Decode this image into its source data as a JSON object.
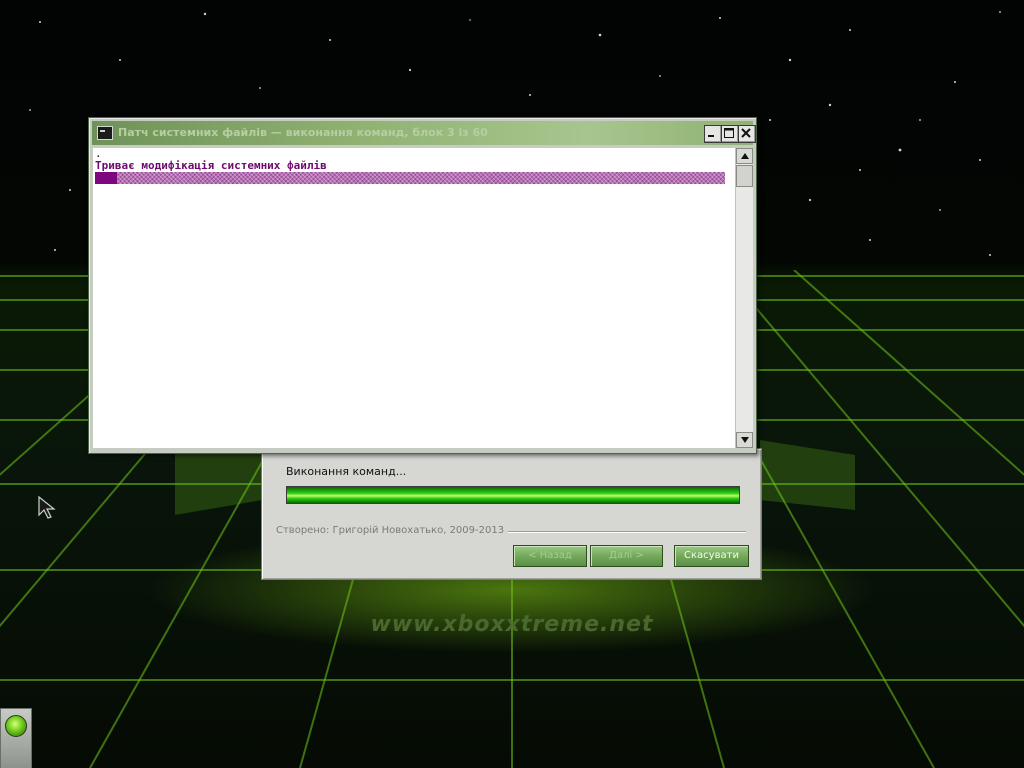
{
  "console": {
    "title": "Патч системних файлів — виконання команд, блок 3 із 60",
    "first_line": ".",
    "status_line": "Триває модифікація системних файлів",
    "progress_fraction": 0.035,
    "icons": {
      "app": "console-icon",
      "minimize": "minimize-icon",
      "maximize": "maximize-icon",
      "close": "close-icon"
    }
  },
  "installer": {
    "step_text": "Виконання команд...",
    "progress_fraction": 1.0,
    "credit": "Створено: Григорій Новохатько, 2009-2013",
    "buttons": {
      "back": "< Назад",
      "next": "Далі >",
      "cancel": "Скасувати"
    }
  },
  "desktop": {
    "watermark": "www.xboxxtreme.net",
    "accent_color": "#7dd31a"
  }
}
